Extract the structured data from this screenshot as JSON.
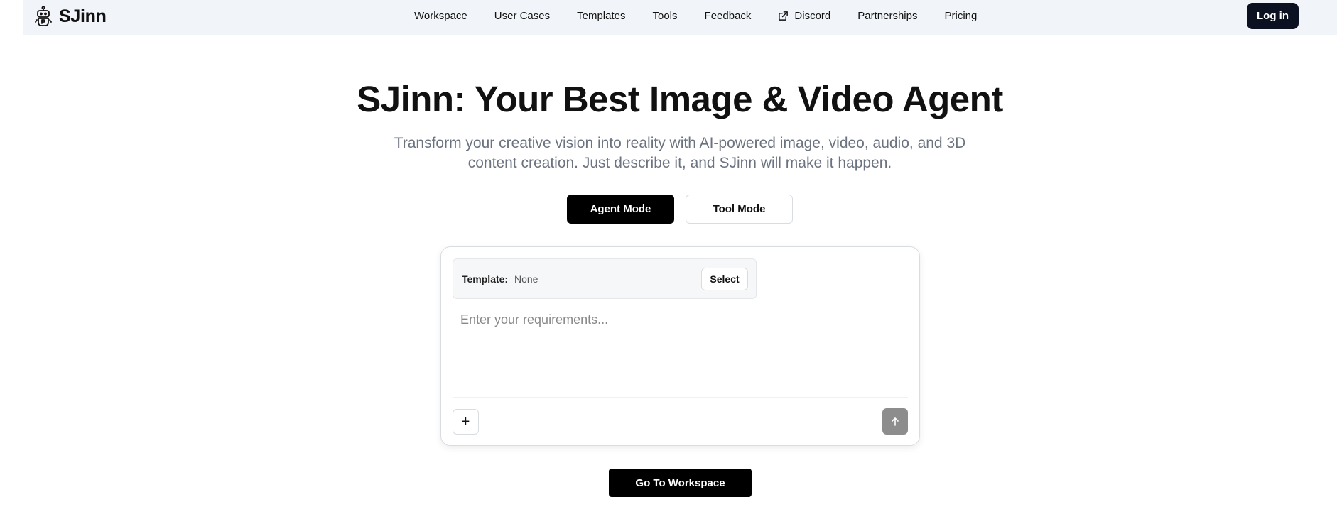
{
  "header": {
    "brand": "SJinn",
    "nav": [
      {
        "label": "Workspace",
        "icon": null
      },
      {
        "label": "User Cases",
        "icon": null
      },
      {
        "label": "Templates",
        "icon": null
      },
      {
        "label": "Tools",
        "icon": null
      },
      {
        "label": "Feedback",
        "icon": null
      },
      {
        "label": "Discord",
        "icon": "external-link-icon"
      },
      {
        "label": "Partnerships",
        "icon": null
      },
      {
        "label": "Pricing",
        "icon": null
      }
    ],
    "login_label": "Log in"
  },
  "hero": {
    "title": "SJinn: Your Best Image & Video Agent",
    "subtitle_line1": "Transform your creative vision into reality with AI-powered image, video, audio, and 3D",
    "subtitle_line2": "content creation. Just describe it, and SJinn will make it happen."
  },
  "modes": {
    "agent_label": "Agent Mode",
    "tool_label": "Tool Mode",
    "selected": "Agent Mode"
  },
  "composer": {
    "template_label": "Template:",
    "template_value": "None",
    "select_label": "Select",
    "input_placeholder": "Enter your requirements...",
    "input_value": "",
    "add_symbol": "+"
  },
  "workspace_button_label": "Go To Workspace",
  "colors": {
    "header_bg": "#f1f4f8",
    "primary": "#000000",
    "login_bg": "#0b1120",
    "muted_text": "#6b7280",
    "send_disabled": "#8d8d8d"
  }
}
